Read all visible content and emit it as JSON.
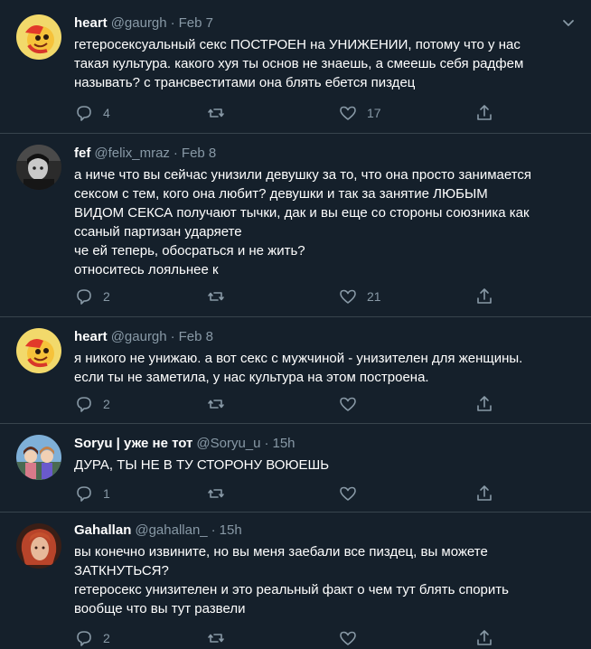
{
  "tweets": [
    {
      "name": "heart",
      "handle": "@gaurgh",
      "date": "Feb 7",
      "avatar_icon": "cartoon-face-avatar",
      "lines": [
        "гетеросексуальный секс ПОСТРОЕН на УНИЖЕНИИ, потому что у нас",
        "такая культура. какого хуя ты основ не знаешь, а смеешь себя радфем",
        "называть? с трансвеститами она блять ебется пиздец"
      ],
      "replies": "4",
      "retweets": "",
      "likes": "17"
    },
    {
      "name": "fef",
      "handle": "@felix_mraz",
      "date": "Feb 8",
      "avatar_icon": "dark-photo-avatar",
      "lines": [
        "а ниче что вы сейчас унизили девушку за то, что она просто занимается",
        "сексом с тем, кого она любит? девушки и так за занятие ЛЮБЫМ",
        "ВИДОМ СЕКСА получают тычки, дак и вы еще со стороны союзника как",
        "ссаный партизан ударяете",
        "че ей теперь, обосраться и не жить?",
        "относитесь лояльнее к"
      ],
      "replies": "2",
      "retweets": "",
      "likes": "21"
    },
    {
      "name": "heart",
      "handle": "@gaurgh",
      "date": "Feb 8",
      "avatar_icon": "cartoon-face-avatar",
      "lines": [
        "я никого не унижаю. а вот секс с мужчиной - унизителен для женщины.",
        "если ты не заметила, у нас культура на этом построена."
      ],
      "replies": "2",
      "retweets": "",
      "likes": ""
    },
    {
      "name": "Soryu | уже не тот",
      "handle": "@Soryu_u",
      "date": "15h",
      "avatar_icon": "anime-characters-avatar",
      "lines": [
        "ДУРА, ТЫ НЕ В ТУ СТОРОНУ ВОЮЕШЬ"
      ],
      "replies": "1",
      "retweets": "",
      "likes": ""
    },
    {
      "name": "Gahallan",
      "handle": "@gahallan_",
      "date": "15h",
      "avatar_icon": "red-hair-portrait-avatar",
      "lines": [
        "вы конечно извините, но вы меня заебали все пиздец, вы можете",
        "ЗАТКНУТЬСЯ?",
        "гетеросекс унизителен и это реальный факт о чем тут блять спорить",
        "вообще что вы тут развели"
      ],
      "replies": "2",
      "retweets": "",
      "likes": ""
    }
  ],
  "colors": {
    "background": "#15202b",
    "secondary_text": "#8899a6",
    "divider": "#38444d"
  }
}
